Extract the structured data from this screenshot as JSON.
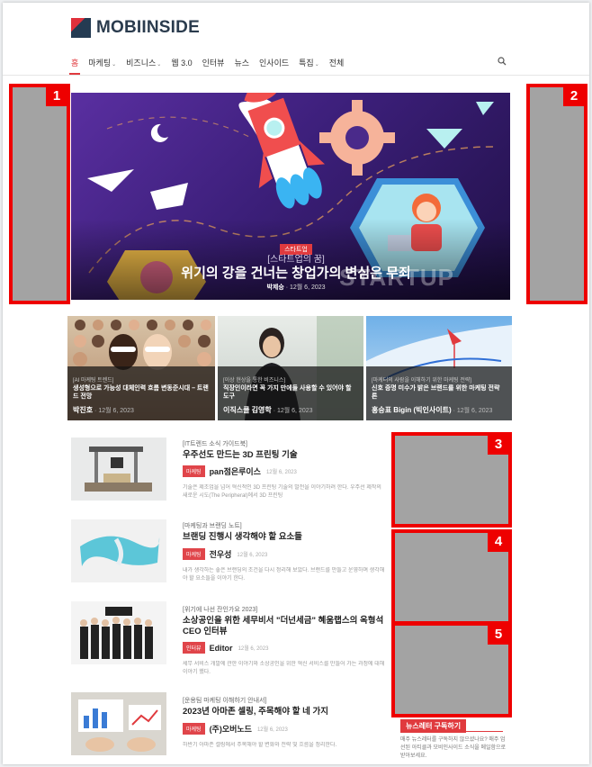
{
  "site": {
    "logo_text": "MOBIINSIDE"
  },
  "nav": {
    "items": [
      {
        "label": "홈",
        "caret": ""
      },
      {
        "label": "마케팅",
        "caret": "⌄"
      },
      {
        "label": "비즈니스",
        "caret": "⌄"
      },
      {
        "label": "웹 3.0",
        "caret": ""
      },
      {
        "label": "인터뷰",
        "caret": ""
      },
      {
        "label": "뉴스",
        "caret": ""
      },
      {
        "label": "인사이드",
        "caret": ""
      },
      {
        "label": "특집",
        "caret": "⌄"
      },
      {
        "label": "전체",
        "caret": ""
      }
    ],
    "active_index": 0
  },
  "ads": [
    {
      "label": "1"
    },
    {
      "label": "2"
    },
    {
      "label": "3"
    },
    {
      "label": "4"
    },
    {
      "label": "5"
    }
  ],
  "hero": {
    "category": "스타트업",
    "subtitle": "[스타트업의 꿈]",
    "title": "위기의 강을 건너는 창업가의 변심은 무죄",
    "author": "박제승",
    "date": "12월 6, 2023",
    "watermark": "STARTUP"
  },
  "cards": [
    {
      "category": "[AI 마케팅 트렌드]",
      "title": "생성형으로 가능성 대체인력 흐름 변동준시대 – 트랜드 전망",
      "author": "박진호",
      "date": "12월 6, 2023"
    },
    {
      "category": "[이상 현상을 통한 비즈니스]",
      "title": "직장인이라면 꼭 가지 만에들 사용할 수 있어야 할 도구",
      "author": "이직스쿨 김영학",
      "date": "12월 6, 2023"
    },
    {
      "category": "[마케터의 사람을 이해하기 위한 마케팅 전략]",
      "title": "신호 증명 미수가 밝은 브랜드를 위한 마케팅 전략 론",
      "author": "홍승표 Bigin (빅인사이트)",
      "date": "12월 6, 2023"
    }
  ],
  "list": [
    {
      "category": "[IT트렌드 소식 가이드북]",
      "title": "우주선도 만드는 3D 프린팅 기술",
      "badge": "마케팅",
      "author": "pan점은루이스",
      "date": "12월 6, 2023",
      "excerpt": "기술은 제조업을 넘어 혁신적인 3D 프린팅 기술의 발전을 이야기하려 한다. 우주선 제작의 새로운 시도(The Peripheral)에서 3D 프린팅"
    },
    {
      "category": "[마케팅과 브랜딩 노트]",
      "title": "브랜딩 진행시 생각해야 할 요소들",
      "badge": "마케팅",
      "author": "전우성",
      "date": "12월 6, 2023",
      "excerpt": "내가 생각하는 좋은 브랜딩의 조건을 다시 정리해 보았다. 브랜드를 만들고 운영하며 생각해야 할 요소들을 이야기 한다."
    },
    {
      "category": "[위기에 나선 잔인가요 2023]",
      "title": "소상공인을 위한 세무비서 \"더넌세금\" 혜움랩스의 옥형석 CEO 인터뷰",
      "badge": "인터뷰",
      "author": "Editor",
      "date": "12월 6, 2023",
      "excerpt": "세무 서비스 개발에 관한 이야기와 소상공인을 위한 혁신 서비스를 만들어 가는 과정에 대해 이야기 했다."
    },
    {
      "category": "[운용팀 마케팅 이해하기 안내서]",
      "title": "2023년 아마존 셀링, 주목해야 할 네 가지",
      "badge": "마케팅",
      "author": "(주)오버노드",
      "date": "12월 6, 2023",
      "excerpt": "하반기 아마존 셀링에서 주목해야 할 변화와 전략 및 흐름을 정리한다."
    }
  ],
  "newsletter": {
    "title": "뉴스레터 구독하기",
    "text": "매주 뉴스레터를 구독하지 않으셨나요? 매주 엄선된 아티클과 모비인사이드 소식을 메일함으로 받아보세요."
  }
}
